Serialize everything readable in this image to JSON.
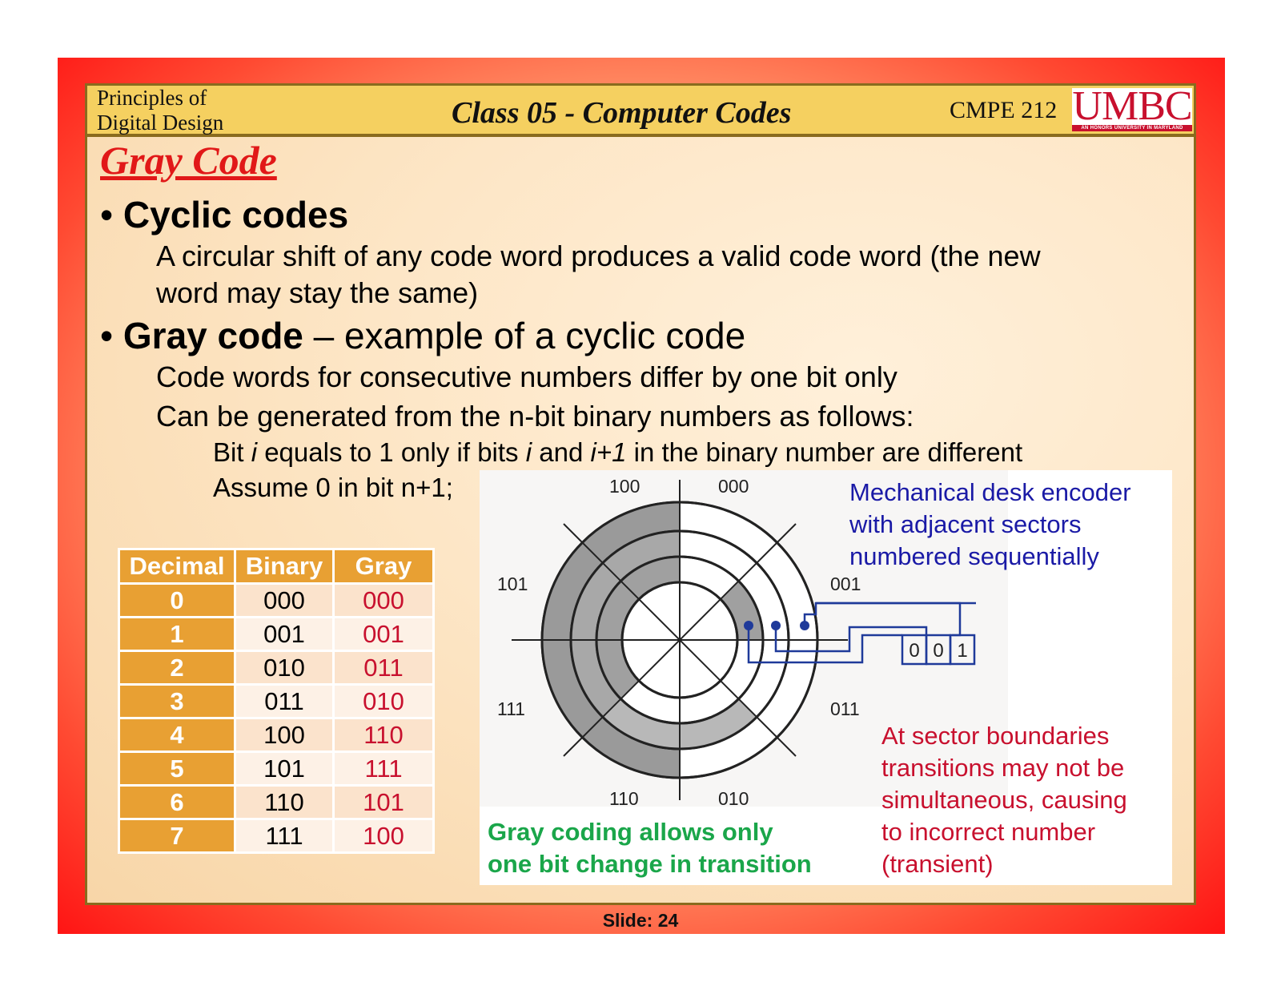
{
  "header": {
    "course_line1": "Principles of",
    "course_line2": "Digital Design",
    "class_title": "Class 05 - Computer Codes",
    "course_code": "CMPE 212",
    "logo_text": "UMBC",
    "logo_tagline": "AN HONORS UNIVERSITY IN MARYLAND"
  },
  "title": "Gray Code",
  "bullets": {
    "b1_head": "Cyclic codes",
    "b1_line1": "A circular shift of any code word produces a valid code word (the new",
    "b1_line2": "word may stay the same)",
    "b2_head_bold": "Gray code",
    "b2_head_rest": "– example of a cyclic code",
    "b2_line1": "Code words for consecutive numbers differ by one bit only",
    "b2_line2": "Can be generated from the n-bit binary numbers as follows:",
    "b2_sub1_a": "Bit ",
    "b2_sub1_i": "i",
    "b2_sub1_b": " equals to 1 only if bits ",
    "b2_sub1_i2": "i",
    "b2_sub1_c": " and ",
    "b2_sub1_i3": "i+1",
    "b2_sub1_d": " in the binary number are different",
    "b2_sub2": "Assume 0 in bit n+1;"
  },
  "table": {
    "headers": [
      "Decimal",
      "Binary",
      "Gray"
    ],
    "rows": [
      [
        "0",
        "000",
        "000"
      ],
      [
        "1",
        "001",
        "001"
      ],
      [
        "2",
        "010",
        "011"
      ],
      [
        "3",
        "011",
        "010"
      ],
      [
        "4",
        "100",
        "110"
      ],
      [
        "5",
        "101",
        "111"
      ],
      [
        "6",
        "110",
        "101"
      ],
      [
        "7",
        "111",
        "100"
      ]
    ]
  },
  "encoder": {
    "sector_labels": [
      "100",
      "000",
      "101",
      "001",
      "111",
      "011",
      "110",
      "010"
    ],
    "readout": [
      "0",
      "0",
      "1"
    ]
  },
  "notes": {
    "blue": [
      "Mechanical desk encoder",
      "with adjacent sectors",
      "numbered sequentially"
    ],
    "red": [
      "At sector boundaries",
      "transitions may not be",
      "simultaneous, causing",
      "to incorrect number",
      "(transient)"
    ],
    "green": [
      "Gray coding allows only",
      "one bit change in transition"
    ]
  },
  "colors": {
    "accent_red": "#e11818",
    "note_blue": "#1a1aa6",
    "note_red": "#c8102e",
    "note_green": "#1aa64a",
    "table_header": "#e8a033"
  },
  "footer": {
    "slide_number": "Slide: 24"
  }
}
